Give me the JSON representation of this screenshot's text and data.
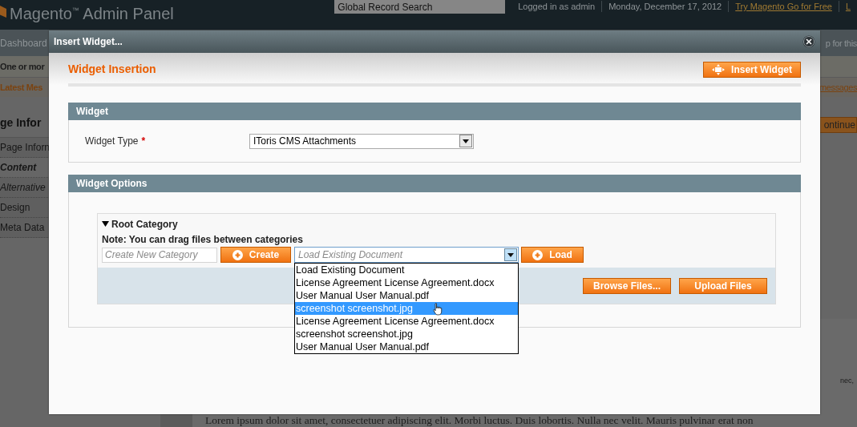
{
  "header": {
    "logo": "Magento$^{™}$ Admin Panel",
    "search": {
      "placeholder": "Global Record Search"
    },
    "links": [
      {
        "label": "Logged in as admin",
        "kind": "text"
      },
      {
        "label": "Monday, December 17, 2012",
        "kind": "text"
      },
      {
        "label": "Try Magento Go for Free",
        "kind": "link"
      },
      {
        "label": "L",
        "kind": "link"
      }
    ]
  },
  "nav": {
    "items": [
      "Dashboard"
    ],
    "help_link": "p for this"
  },
  "messages": [
    {
      "text": "One or mor",
      "kind": "notice"
    },
    {
      "text": "Latest Mes",
      "kind": "link",
      "link": "messages"
    }
  ],
  "sidebar": {
    "title": "ge Infor",
    "tabs": [
      {
        "label": "Page Inforn",
        "selected": false,
        "changed": false
      },
      {
        "label": "Content",
        "selected": true,
        "changed": true
      },
      {
        "label": "Alternative",
        "selected": false,
        "changed": true
      },
      {
        "label": "Design",
        "selected": false,
        "changed": false
      },
      {
        "label": "Meta Data",
        "selected": false,
        "changed": false
      }
    ]
  },
  "continue_button": "ontinue",
  "editor": {
    "side_text": "nec,",
    "body": "Lorem ipsum dolor sit amet, consectetuer adipiscing elit. Morbi luctus. Duis lobortis. Nulla nec velit. Mauris pulvinar erat non"
  },
  "dialog": {
    "title": "Insert Widget...",
    "heading": "Widget Insertion",
    "insert_button": "Insert Widget",
    "widget_section": {
      "title": "Widget",
      "field_label": "Widget Type",
      "required_mark": "*",
      "value": "IToris CMS Attachments"
    },
    "options_section": {
      "title": "Widget Options",
      "category": {
        "name": "Root Category",
        "expanded": true,
        "note": "Note: You can drag files between categories",
        "new_category": {
          "placeholder": "Create New Category"
        },
        "create_button": "Create",
        "document_select": {
          "placeholder": "Load Existing Document",
          "open": true,
          "options": [
            {
              "label": "Load Existing Document",
              "selected": false
            },
            {
              "label": "License Agreement License Agreement.docx",
              "selected": false
            },
            {
              "label": "User Manual User Manual.pdf",
              "selected": false
            },
            {
              "label": "screenshot screenshot.jpg",
              "selected": true
            },
            {
              "label": "License Agreement License Agreement.docx",
              "selected": false
            },
            {
              "label": "screenshot screenshot.jpg",
              "selected": false
            },
            {
              "label": "User Manual User Manual.pdf",
              "selected": false
            }
          ]
        },
        "load_button": "Load",
        "browse_button": "Browse Files...",
        "upload_button": "Upload Files"
      }
    }
  }
}
